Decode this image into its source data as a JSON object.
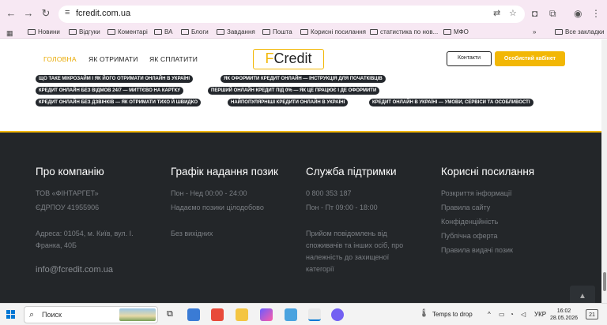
{
  "browser": {
    "url": "fcredit.com.ua",
    "bookmarks": [
      "Новини",
      "Відгуки",
      "Коментарі",
      "ВА",
      "Блоги",
      "Завдання",
      "Пошта",
      "Корисні посилання",
      "статистика по нов...",
      "МФО"
    ],
    "all_bookmarks": "Все закладки"
  },
  "header": {
    "menu": [
      "ГОЛОВНА",
      "ЯК ОТРИМАТИ",
      "ЯК СПЛАТИТИ"
    ],
    "logo_f": "F",
    "logo_rest": "Credit",
    "contacts_btn": "Контакти",
    "cabinet_btn": "Особистий кабінет"
  },
  "tags": [
    "ЩО ТАКЕ МІКРОЗАЙМ І ЯК ЙОГО ОТРИМАТИ ОНЛАЙН В УКРАЇНІ",
    "ЯК ОФОРМИТИ КРЕДИТ ОНЛАЙН — ІНСТРУКЦІЯ ДЛЯ ПОЧАТКІВЦІВ",
    "КРЕДИТ ОНЛАЙН БЕЗ ВІДМОВ 24/7 — МИТТЄВО НА КАРТКУ",
    "ПЕРШИЙ ОНЛАЙН КРЕДИТ ПІД 0% — ЯК ЦЕ ПРАЦЮЄ І ДЕ ОФОРМИТИ",
    "КРЕДИТ ОНЛАЙН БЕЗ ДЗВІНКІВ — ЯК ОТРИМАТИ ТИХО Й ШВИДКО",
    "НАЙПОПУЛЯРНІШІ КРЕДИТИ ОНЛАЙН В УКРАЇНІ",
    "КРЕДИТ ОНЛАЙН В УКРАЇНІ — УМОВИ, СЕРВІСИ ТА ОСОБЛИВОСТІ"
  ],
  "footer": {
    "company": {
      "title": "Про компанію",
      "name": "ТОВ «ФІНТАРГЕТ»",
      "edrpou": "ЄДРПОУ 41955906",
      "address_1": "Адреса: 01054, м. Київ, вул. І.",
      "address_2": "Франка, 40Б",
      "email": "info@fcredit.com.ua"
    },
    "schedule": {
      "title": "Графік надання позик",
      "hours": "Пон - Нед 00:00 - 24:00",
      "note": "Надаємо позики цілодобово",
      "weekend": "Без вихідних"
    },
    "support": {
      "title": "Служба підтримки",
      "phone": "0 800 353 187",
      "hours": "Пон - Пт 09:00 - 18:00",
      "note_1": "Прийом повідомлень від",
      "note_2": "споживачів та інших осіб, про",
      "note_3": "належність до захищеної",
      "note_4": "категорії"
    },
    "links": {
      "title": "Корисні посилання",
      "items": [
        "Розкриття інформації",
        "Правила сайту",
        "Конфіденційність",
        "Публічна оферта",
        "Правила видачі позик"
      ]
    }
  },
  "taskbar": {
    "search": "Поиск",
    "weather": "Temps to drop",
    "lang": "УКР",
    "time": "16:02",
    "date": "28.05.2026",
    "notifications": "21"
  }
}
